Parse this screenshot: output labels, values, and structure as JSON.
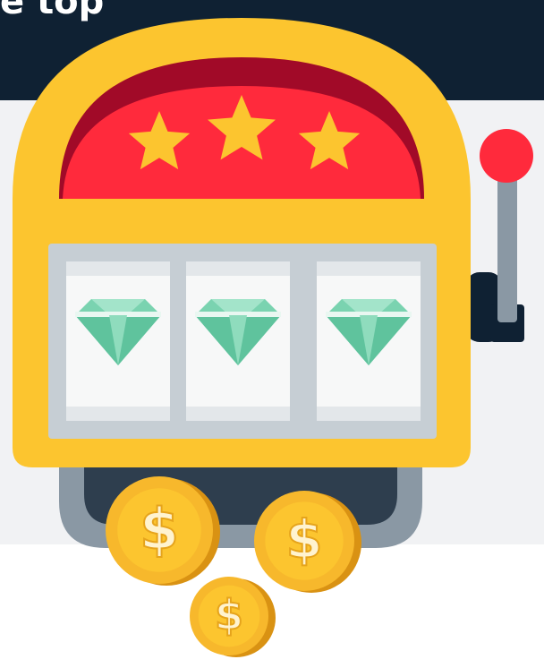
{
  "heading": {
    "text": "e top"
  },
  "illustration": {
    "reel_symbols": [
      "diamond-icon",
      "diamond-icon",
      "diamond-icon"
    ],
    "top_symbols": [
      "star-icon",
      "star-icon",
      "star-icon"
    ],
    "coin_label": "$",
    "colors": {
      "header_bg": "#0f2133",
      "band_bg": "#f1f2f4",
      "machine_body": "#fcc52f",
      "dome_red": "#ff2a3c",
      "dome_dark": "#a10a28",
      "star": "#fcc52f",
      "reel_frame": "#c6ced4",
      "reel_window": "#f7f8f8",
      "diamond": "#7ad3b0",
      "lever_knob": "#ff2a3c",
      "tray": "#2e3e4e",
      "coin": "#f7b82c"
    }
  }
}
